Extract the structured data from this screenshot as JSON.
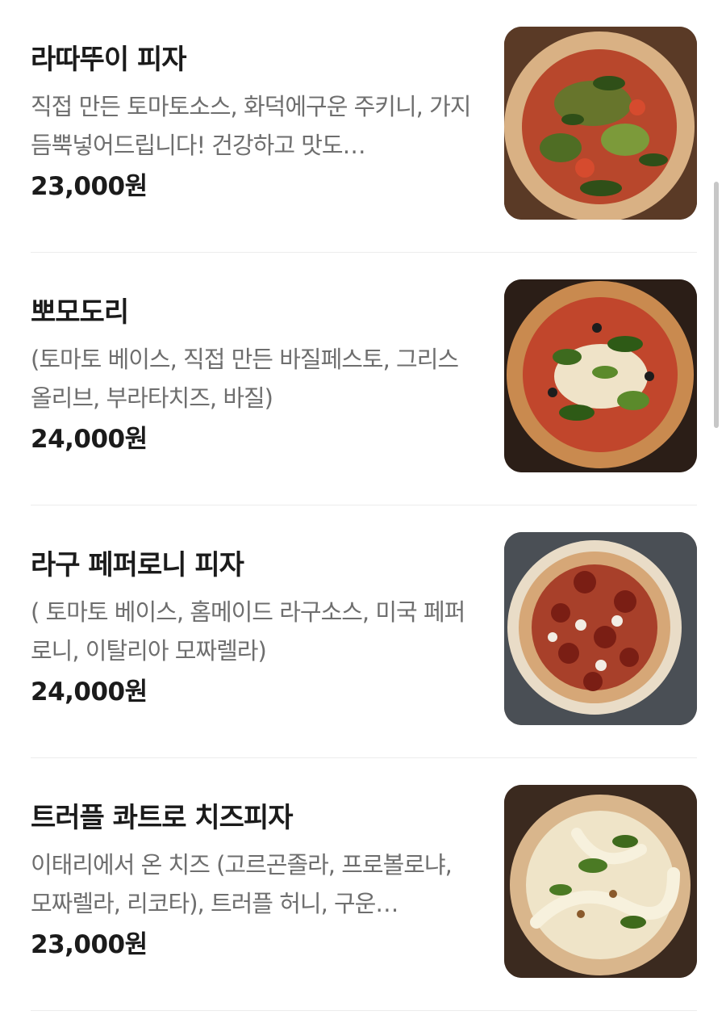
{
  "menu": {
    "items": [
      {
        "name": "라따뚜이 피자",
        "description": "직접 만든 토마토소스, 화덕에구운 주키니, 가지 듬뿍넣어드립니다! 건강하고 맛도…",
        "price": "23,000원"
      },
      {
        "name": "뽀모도리",
        "description": "(토마토 베이스, 직접 만든 바질페스토, 그리스 올리브, 부라타치즈, 바질)",
        "price": "24,000원"
      },
      {
        "name": "라구 페퍼로니 피자",
        "description": "( 토마토 베이스, 홈메이드 라구소스, 미국 페퍼로니, 이탈리아 모짜렐라)",
        "price": "24,000원"
      },
      {
        "name": "트러플 콰트로 치즈피자",
        "description": "이태리에서 온 치즈 (고르곤졸라, 프로볼로냐, 모짜렐라, 리코타), 트러플 허니, 구운…",
        "price": "23,000원"
      }
    ]
  }
}
